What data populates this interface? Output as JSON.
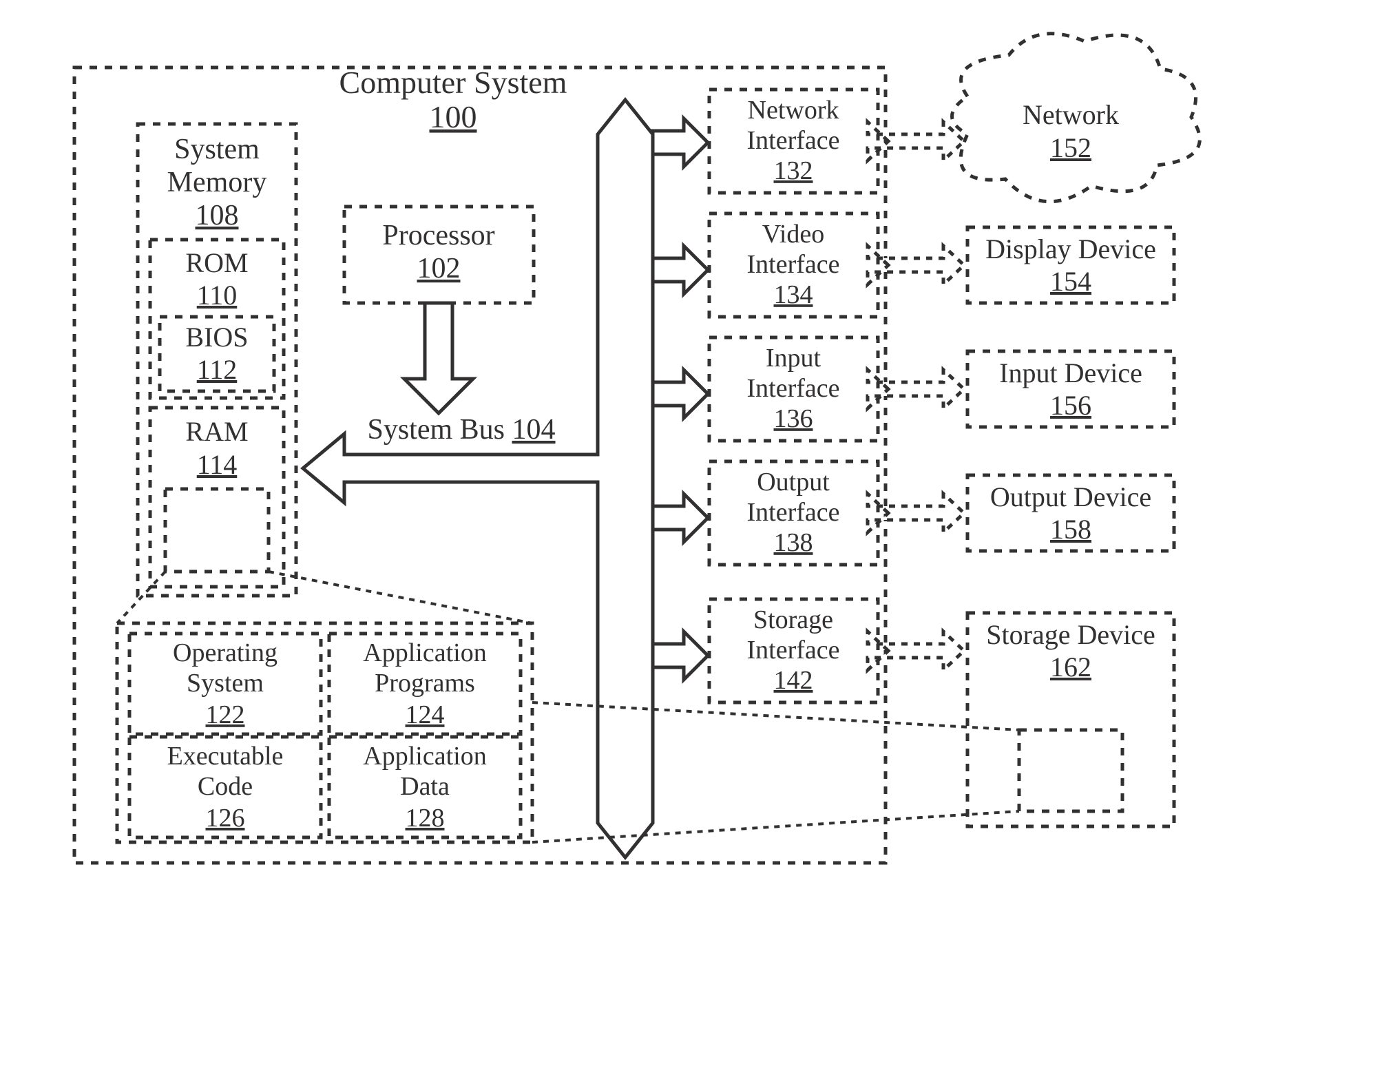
{
  "computer_system": {
    "label": "Computer System",
    "num": "100"
  },
  "system_memory": {
    "label": "System",
    "label2": "Memory",
    "num": "108"
  },
  "rom": {
    "label": "ROM",
    "num": "110"
  },
  "bios": {
    "label": "BIOS",
    "num": "112"
  },
  "ram": {
    "label": "RAM",
    "num": "114"
  },
  "processor": {
    "label": "Processor",
    "num": "102"
  },
  "bus": {
    "label": "System Bus",
    "num": "104"
  },
  "os": {
    "label": "Operating",
    "label2": "System",
    "num": "122"
  },
  "apps": {
    "label": "Application",
    "label2": "Programs",
    "num": "124"
  },
  "exe": {
    "label": "Executable",
    "label2": "Code",
    "num": "126"
  },
  "appdata": {
    "label": "Application",
    "label2": "Data",
    "num": "128"
  },
  "net_if": {
    "label": "Network",
    "label2": "Interface",
    "num": "132"
  },
  "vid_if": {
    "label": "Video",
    "label2": "Interface",
    "num": "134"
  },
  "in_if": {
    "label": "Input",
    "label2": "Interface",
    "num": "136"
  },
  "out_if": {
    "label": "Output",
    "label2": "Interface",
    "num": "138"
  },
  "stor_if": {
    "label": "Storage",
    "label2": "Interface",
    "num": "142"
  },
  "network": {
    "label": "Network",
    "num": "152"
  },
  "display": {
    "label": "Display Device",
    "num": "154"
  },
  "input_dev": {
    "label": "Input Device",
    "num": "156"
  },
  "output_dev": {
    "label": "Output Device",
    "num": "158"
  },
  "storage_dev": {
    "label": "Storage Device",
    "num": "162"
  }
}
